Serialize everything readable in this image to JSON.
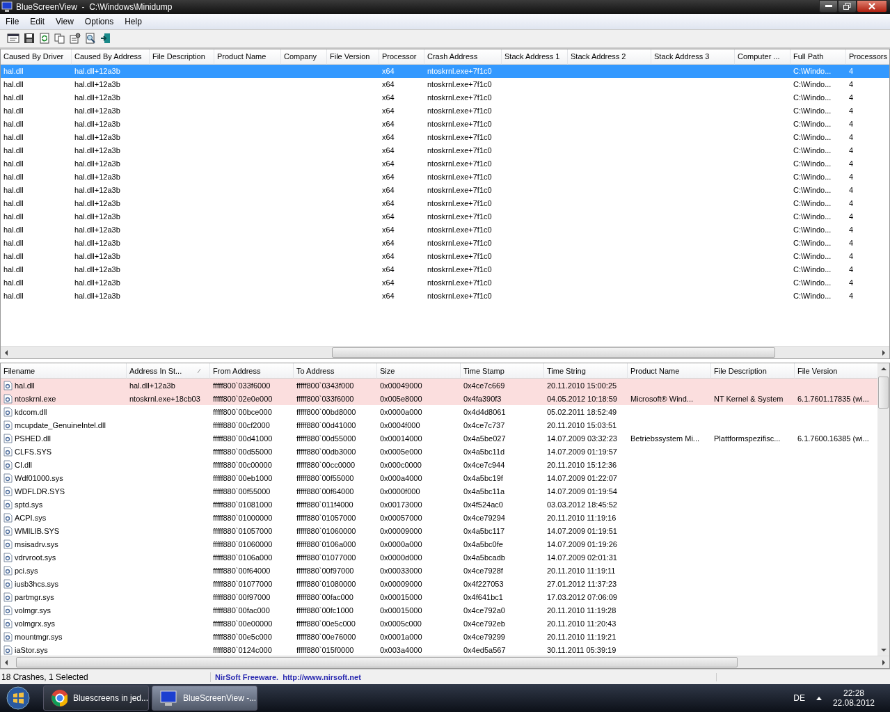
{
  "window": {
    "title": "BlueScreenView  -  C:\\Windows\\Minidump"
  },
  "menu": [
    "File",
    "Edit",
    "View",
    "Options",
    "Help"
  ],
  "top_table": {
    "columns": [
      "Caused By Driver",
      "Caused By Address",
      "File Description",
      "Product Name",
      "Company",
      "File Version",
      "Processor",
      "Crash Address",
      "Stack Address 1",
      "Stack Address 2",
      "Stack Address 3",
      "Computer ...",
      "Full Path",
      "Processors"
    ],
    "rows": [
      {
        "selected": true,
        "driver": "hal.dll",
        "address": "hal.dll+12a3b",
        "processor": "x64",
        "crash_address": "ntoskrnl.exe+7f1c0",
        "full_path": "C:\\Windo...",
        "processors": "4"
      },
      {
        "selected": false,
        "driver": "hal.dll",
        "address": "hal.dll+12a3b",
        "processor": "x64",
        "crash_address": "ntoskrnl.exe+7f1c0",
        "full_path": "C:\\Windo...",
        "processors": "4"
      },
      {
        "selected": false,
        "driver": "hal.dll",
        "address": "hal.dll+12a3b",
        "processor": "x64",
        "crash_address": "ntoskrnl.exe+7f1c0",
        "full_path": "C:\\Windo...",
        "processors": "4"
      },
      {
        "selected": false,
        "driver": "hal.dll",
        "address": "hal.dll+12a3b",
        "processor": "x64",
        "crash_address": "ntoskrnl.exe+7f1c0",
        "full_path": "C:\\Windo...",
        "processors": "4"
      },
      {
        "selected": false,
        "driver": "hal.dll",
        "address": "hal.dll+12a3b",
        "processor": "x64",
        "crash_address": "ntoskrnl.exe+7f1c0",
        "full_path": "C:\\Windo...",
        "processors": "4"
      },
      {
        "selected": false,
        "driver": "hal.dll",
        "address": "hal.dll+12a3b",
        "processor": "x64",
        "crash_address": "ntoskrnl.exe+7f1c0",
        "full_path": "C:\\Windo...",
        "processors": "4"
      },
      {
        "selected": false,
        "driver": "hal.dll",
        "address": "hal.dll+12a3b",
        "processor": "x64",
        "crash_address": "ntoskrnl.exe+7f1c0",
        "full_path": "C:\\Windo...",
        "processors": "4"
      },
      {
        "selected": false,
        "driver": "hal.dll",
        "address": "hal.dll+12a3b",
        "processor": "x64",
        "crash_address": "ntoskrnl.exe+7f1c0",
        "full_path": "C:\\Windo...",
        "processors": "4"
      },
      {
        "selected": false,
        "driver": "hal.dll",
        "address": "hal.dll+12a3b",
        "processor": "x64",
        "crash_address": "ntoskrnl.exe+7f1c0",
        "full_path": "C:\\Windo...",
        "processors": "4"
      },
      {
        "selected": false,
        "driver": "hal.dll",
        "address": "hal.dll+12a3b",
        "processor": "x64",
        "crash_address": "ntoskrnl.exe+7f1c0",
        "full_path": "C:\\Windo...",
        "processors": "4"
      },
      {
        "selected": false,
        "driver": "hal.dll",
        "address": "hal.dll+12a3b",
        "processor": "x64",
        "crash_address": "ntoskrnl.exe+7f1c0",
        "full_path": "C:\\Windo...",
        "processors": "4"
      },
      {
        "selected": false,
        "driver": "hal.dll",
        "address": "hal.dll+12a3b",
        "processor": "x64",
        "crash_address": "ntoskrnl.exe+7f1c0",
        "full_path": "C:\\Windo...",
        "processors": "4"
      },
      {
        "selected": false,
        "driver": "hal.dll",
        "address": "hal.dll+12a3b",
        "processor": "x64",
        "crash_address": "ntoskrnl.exe+7f1c0",
        "full_path": "C:\\Windo...",
        "processors": "4"
      },
      {
        "selected": false,
        "driver": "hal.dll",
        "address": "hal.dll+12a3b",
        "processor": "x64",
        "crash_address": "ntoskrnl.exe+7f1c0",
        "full_path": "C:\\Windo...",
        "processors": "4"
      },
      {
        "selected": false,
        "driver": "hal.dll",
        "address": "hal.dll+12a3b",
        "processor": "x64",
        "crash_address": "ntoskrnl.exe+7f1c0",
        "full_path": "C:\\Windo...",
        "processors": "4"
      },
      {
        "selected": false,
        "driver": "hal.dll",
        "address": "hal.dll+12a3b",
        "processor": "x64",
        "crash_address": "ntoskrnl.exe+7f1c0",
        "full_path": "C:\\Windo...",
        "processors": "4"
      },
      {
        "selected": false,
        "driver": "hal.dll",
        "address": "hal.dll+12a3b",
        "processor": "x64",
        "crash_address": "ntoskrnl.exe+7f1c0",
        "full_path": "C:\\Windo...",
        "processors": "4"
      },
      {
        "selected": false,
        "driver": "hal.dll",
        "address": "hal.dll+12a3b",
        "processor": "x64",
        "crash_address": "ntoskrnl.exe+7f1c0",
        "full_path": "C:\\Windo...",
        "processors": "4"
      }
    ]
  },
  "bottom_table": {
    "columns": [
      "Filename",
      "Address In St...",
      "From Address",
      "To Address",
      "Size",
      "Time Stamp",
      "Time String",
      "Product Name",
      "File Description",
      "File Version"
    ],
    "rows": [
      {
        "highlighted": true,
        "filename": "hal.dll",
        "address_in_stack": "hal.dll+12a3b",
        "from": "fffff800`033f6000",
        "to": "fffff800`0343f000",
        "size": "0x00049000",
        "time_stamp": "0x4ce7c669",
        "time_string": "20.11.2010 15:00:25"
      },
      {
        "highlighted": true,
        "filename": "ntoskrnl.exe",
        "address_in_stack": "ntoskrnl.exe+18cb03",
        "from": "fffff800`02e0e000",
        "to": "fffff800`033f6000",
        "size": "0x005e8000",
        "time_stamp": "0x4fa390f3",
        "time_string": "04.05.2012 10:18:59",
        "product_name": "Microsoft® Wind...",
        "file_description": "NT Kernel & System",
        "file_version": "6.1.7601.17835 (wi..."
      },
      {
        "highlighted": false,
        "filename": "kdcom.dll",
        "from": "fffff800`00bce000",
        "to": "fffff800`00bd8000",
        "size": "0x0000a000",
        "time_stamp": "0x4d4d8061",
        "time_string": "05.02.2011 18:52:49"
      },
      {
        "highlighted": false,
        "filename": "mcupdate_GenuineIntel.dll",
        "from": "fffff880`00cf2000",
        "to": "fffff880`00d41000",
        "size": "0x0004f000",
        "time_stamp": "0x4ce7c737",
        "time_string": "20.11.2010 15:03:51"
      },
      {
        "highlighted": false,
        "filename": "PSHED.dll",
        "from": "fffff880`00d41000",
        "to": "fffff880`00d55000",
        "size": "0x00014000",
        "time_stamp": "0x4a5be027",
        "time_string": "14.07.2009 03:32:23",
        "product_name": "Betriebssystem Mi...",
        "file_description": "Plattformspezifisc...",
        "file_version": "6.1.7600.16385 (wi..."
      },
      {
        "highlighted": false,
        "filename": "CLFS.SYS",
        "from": "fffff880`00d55000",
        "to": "fffff880`00db3000",
        "size": "0x0005e000",
        "time_stamp": "0x4a5bc11d",
        "time_string": "14.07.2009 01:19:57"
      },
      {
        "highlighted": false,
        "filename": "CI.dll",
        "from": "fffff880`00c00000",
        "to": "fffff880`00cc0000",
        "size": "0x000c0000",
        "time_stamp": "0x4ce7c944",
        "time_string": "20.11.2010 15:12:36"
      },
      {
        "highlighted": false,
        "filename": "Wdf01000.sys",
        "from": "fffff880`00eb1000",
        "to": "fffff880`00f55000",
        "size": "0x000a4000",
        "time_stamp": "0x4a5bc19f",
        "time_string": "14.07.2009 01:22:07"
      },
      {
        "highlighted": false,
        "filename": "WDFLDR.SYS",
        "from": "fffff880`00f55000",
        "to": "fffff880`00f64000",
        "size": "0x0000f000",
        "time_stamp": "0x4a5bc11a",
        "time_string": "14.07.2009 01:19:54"
      },
      {
        "highlighted": false,
        "filename": "sptd.sys",
        "from": "fffff880`01081000",
        "to": "fffff880`011f4000",
        "size": "0x00173000",
        "time_stamp": "0x4f524ac0",
        "time_string": "03.03.2012 18:45:52"
      },
      {
        "highlighted": false,
        "filename": "ACPI.sys",
        "from": "fffff880`01000000",
        "to": "fffff880`01057000",
        "size": "0x00057000",
        "time_stamp": "0x4ce79294",
        "time_string": "20.11.2010 11:19:16"
      },
      {
        "highlighted": false,
        "filename": "WMILIB.SYS",
        "from": "fffff880`01057000",
        "to": "fffff880`01060000",
        "size": "0x00009000",
        "time_stamp": "0x4a5bc117",
        "time_string": "14.07.2009 01:19:51"
      },
      {
        "highlighted": false,
        "filename": "msisadrv.sys",
        "from": "fffff880`01060000",
        "to": "fffff880`0106a000",
        "size": "0x0000a000",
        "time_stamp": "0x4a5bc0fe",
        "time_string": "14.07.2009 01:19:26"
      },
      {
        "highlighted": false,
        "filename": "vdrvroot.sys",
        "from": "fffff880`0106a000",
        "to": "fffff880`01077000",
        "size": "0x0000d000",
        "time_stamp": "0x4a5bcadb",
        "time_string": "14.07.2009 02:01:31"
      },
      {
        "highlighted": false,
        "filename": "pci.sys",
        "from": "fffff880`00f64000",
        "to": "fffff880`00f97000",
        "size": "0x00033000",
        "time_stamp": "0x4ce7928f",
        "time_string": "20.11.2010 11:19:11"
      },
      {
        "highlighted": false,
        "filename": "iusb3hcs.sys",
        "from": "fffff880`01077000",
        "to": "fffff880`01080000",
        "size": "0x00009000",
        "time_stamp": "0x4f227053",
        "time_string": "27.01.2012 11:37:23"
      },
      {
        "highlighted": false,
        "filename": "partmgr.sys",
        "from": "fffff880`00f97000",
        "to": "fffff880`00fac000",
        "size": "0x00015000",
        "time_stamp": "0x4f641bc1",
        "time_string": "17.03.2012 07:06:09"
      },
      {
        "highlighted": false,
        "filename": "volmgr.sys",
        "from": "fffff880`00fac000",
        "to": "fffff880`00fc1000",
        "size": "0x00015000",
        "time_stamp": "0x4ce792a0",
        "time_string": "20.11.2010 11:19:28"
      },
      {
        "highlighted": false,
        "filename": "volmgrx.sys",
        "from": "fffff880`00e00000",
        "to": "fffff880`00e5c000",
        "size": "0x0005c000",
        "time_stamp": "0x4ce792eb",
        "time_string": "20.11.2010 11:20:43"
      },
      {
        "highlighted": false,
        "filename": "mountmgr.sys",
        "from": "fffff880`00e5c000",
        "to": "fffff880`00e76000",
        "size": "0x0001a000",
        "time_stamp": "0x4ce79299",
        "time_string": "20.11.2010 11:19:21"
      },
      {
        "highlighted": false,
        "filename": "iaStor.sys",
        "from": "fffff880`0124c000",
        "to": "fffff880`015f0000",
        "size": "0x003a4000",
        "time_stamp": "0x4ed5a567",
        "time_string": "30.11.2011 05:39:19"
      }
    ]
  },
  "status_bar": {
    "count": "18 Crashes, 1 Selected",
    "credit": "NirSoft Freeware.  http://www.nirsoft.net"
  },
  "taskbar": {
    "tasks": [
      {
        "label": "Bluescreens in jed...",
        "selected": false
      },
      {
        "label": "BlueScreenView -...",
        "selected": true
      }
    ],
    "language": "DE",
    "time": "22:28",
    "date": "22.08.2012"
  }
}
